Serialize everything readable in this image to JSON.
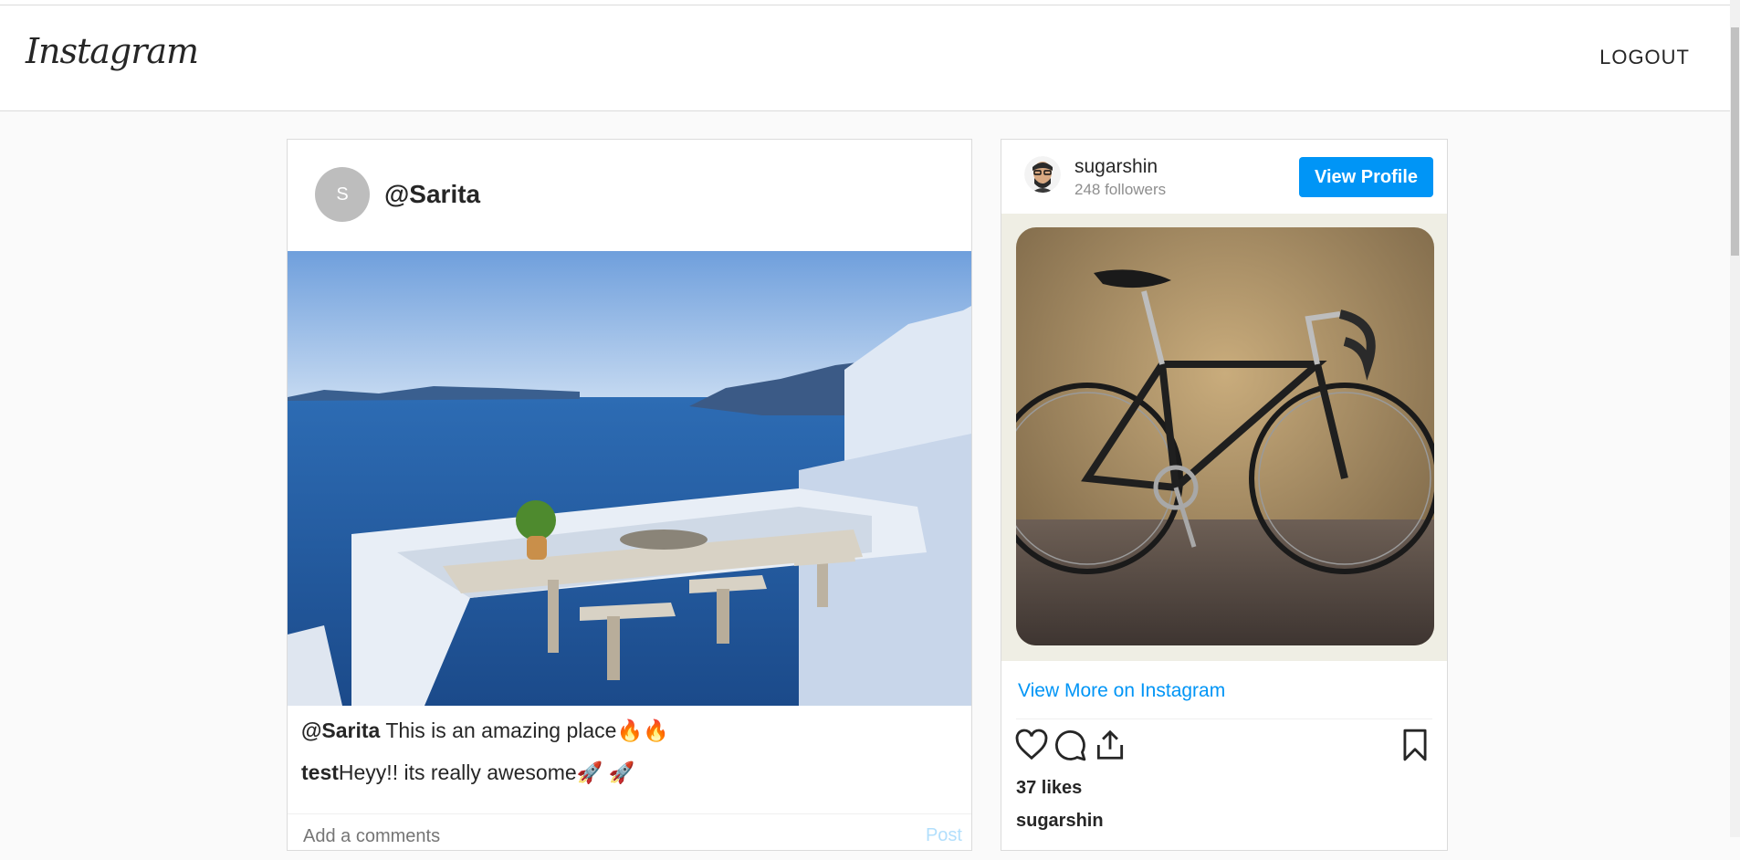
{
  "navbar": {
    "logo": "Instagram",
    "logout_label": "LOGOUT"
  },
  "post": {
    "avatar_initial": "S",
    "username": "@Sarita",
    "caption_user": "@Sarita",
    "caption_text": " This is an amazing place🔥🔥",
    "comment_user": "test",
    "comment_text": "Heyy!! its really awesome🚀 🚀",
    "comment_placeholder": "Add a comments",
    "post_label": "Post"
  },
  "embed": {
    "username": "sugarshin",
    "followers": "248 followers",
    "view_profile_label": "View Profile",
    "view_more_label": "View More on Instagram",
    "likes": "37 likes",
    "owner": "sugarshin",
    "actions": [
      "heart-icon",
      "comment-icon",
      "share-icon",
      "bookmark-icon"
    ]
  },
  "colors": {
    "accent": "#0095f6",
    "text": "#262626",
    "muted": "#8e8e8e",
    "background": "#fafafa"
  }
}
